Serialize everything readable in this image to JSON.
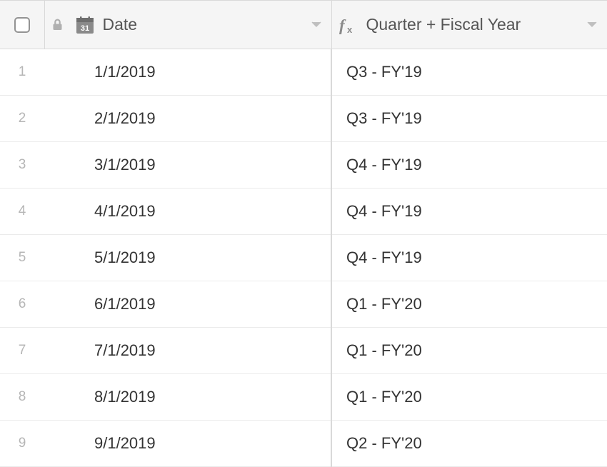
{
  "columns": {
    "date": {
      "label": "Date"
    },
    "formula": {
      "label": "Quarter + Fiscal Year"
    }
  },
  "rows": [
    {
      "num": "1",
      "date": "1/1/2019",
      "formula": "Q3 - FY'19"
    },
    {
      "num": "2",
      "date": "2/1/2019",
      "formula": "Q3 - FY'19"
    },
    {
      "num": "3",
      "date": "3/1/2019",
      "formula": "Q4 - FY'19"
    },
    {
      "num": "4",
      "date": "4/1/2019",
      "formula": "Q4 - FY'19"
    },
    {
      "num": "5",
      "date": "5/1/2019",
      "formula": "Q4 - FY'19"
    },
    {
      "num": "6",
      "date": "6/1/2019",
      "formula": "Q1 - FY'20"
    },
    {
      "num": "7",
      "date": "7/1/2019",
      "formula": "Q1 - FY'20"
    },
    {
      "num": "8",
      "date": "8/1/2019",
      "formula": "Q1 - FY'20"
    },
    {
      "num": "9",
      "date": "9/1/2019",
      "formula": "Q2 - FY'20"
    }
  ]
}
